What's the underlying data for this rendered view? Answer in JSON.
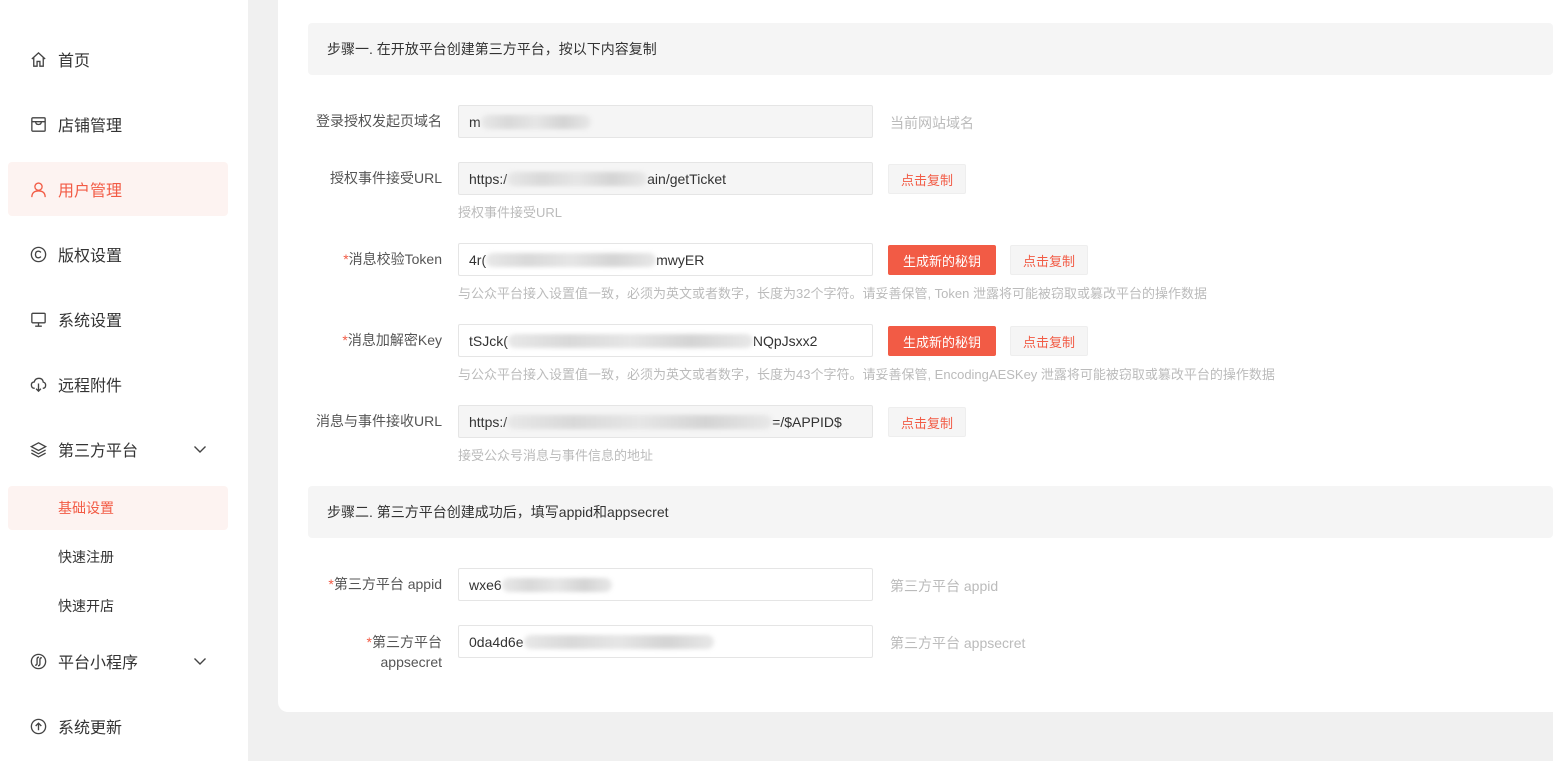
{
  "sidebar": {
    "items": [
      {
        "label": "首页",
        "icon": "home-icon"
      },
      {
        "label": "店铺管理",
        "icon": "store-icon"
      },
      {
        "label": "用户管理",
        "icon": "user-icon"
      },
      {
        "label": "版权设置",
        "icon": "copyright-icon"
      },
      {
        "label": "系统设置",
        "icon": "monitor-icon"
      },
      {
        "label": "远程附件",
        "icon": "cloud-download-icon"
      },
      {
        "label": "第三方平台",
        "icon": "layers-icon"
      },
      {
        "label": "平台小程序",
        "icon": "miniprogram-icon"
      },
      {
        "label": "系统更新",
        "icon": "upload-circle-icon"
      }
    ],
    "sub_items": [
      {
        "label": "基础设置"
      },
      {
        "label": "快速注册"
      },
      {
        "label": "快速开店"
      }
    ]
  },
  "step1": {
    "title": "步骤一. 在开放平台创建第三方平台，按以下内容复制"
  },
  "step2": {
    "title": "步骤二. 第三方平台创建成功后，填写appid和appsecret"
  },
  "fields": {
    "login_domain": {
      "label": "登录授权发起页域名",
      "value_start": "m",
      "value_end": "",
      "hint": "当前网站域名"
    },
    "auth_url": {
      "label": "授权事件接受URL",
      "value_start": "https:/",
      "value_end": "ain/getTicket",
      "hint": "授权事件接受URL"
    },
    "token": {
      "required": "*",
      "label": "消息校验Token",
      "value_start": "4r(",
      "value_end": "mwyER",
      "hint": "与公众平台接入设置值一致，必须为英文或者数字，长度为32个字符。请妥善保管, Token 泄露将可能被窃取或篡改平台的操作数据"
    },
    "aes_key": {
      "required": "*",
      "label": "消息加解密Key",
      "value_start": "tSJck(",
      "value_end": "NQpJsxx2",
      "hint": "与公众平台接入设置值一致，必须为英文或者数字，长度为43个字符。请妥善保管, EncodingAESKey 泄露将可能被窃取或篡改平台的操作数据"
    },
    "msg_url": {
      "label": "消息与事件接收URL",
      "value_start": "https:/",
      "value_end": "=/$APPID$",
      "hint": "接受公众号消息与事件信息的地址"
    },
    "appid": {
      "required": "*",
      "label": "第三方平台 appid",
      "value_start": "wxe6",
      "value_end": "",
      "hint": "第三方平台 appid"
    },
    "appsecret": {
      "required": "*",
      "label_line1": "第三方平台",
      "label_line2": "appsecret",
      "value_start": "0da4d6e",
      "value_end": "",
      "hint": "第三方平台 appsecret"
    }
  },
  "buttons": {
    "copy": "点击复制",
    "generate": "生成新的秘钥"
  },
  "colors": {
    "accent": "#f25b45",
    "active_bg": "#fdf3f1"
  }
}
